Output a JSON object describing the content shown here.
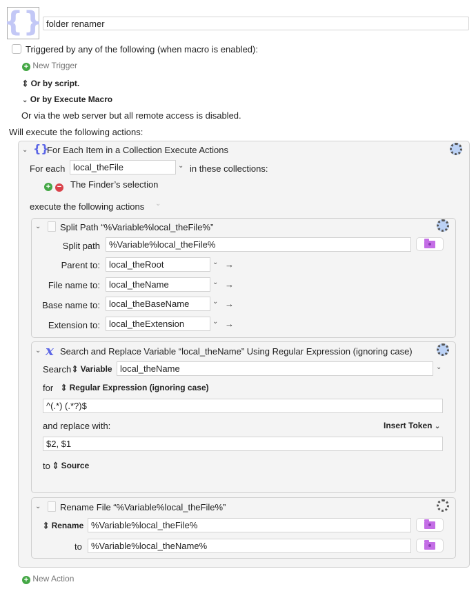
{
  "macro": {
    "name": "folder renamer",
    "icon": "curly-braces-icon"
  },
  "triggers": {
    "checkbox_label": "Triggered by any of the following (when macro is enabled):",
    "new_trigger": "New Trigger",
    "or_by_script": "Or by script.",
    "or_by_execute_macro": "Or by Execute Macro",
    "web_server_note": "Or via the web server but all remote access is disabled."
  },
  "will_execute_label": "Will execute the following actions:",
  "for_each": {
    "title": "For Each Item in a Collection Execute Actions",
    "for_each_label": "For each",
    "variable": "local_theFile",
    "in_collections_label": "in these collections:",
    "collection_item": "The Finder’s selection",
    "execute_label": "execute the following actions"
  },
  "split_path": {
    "title": "Split Path “%Variable%local_theFile%”",
    "split_path_label": "Split path",
    "split_path_value": "%Variable%local_theFile%",
    "rows": [
      {
        "label": "Parent to:",
        "value": "local_theRoot"
      },
      {
        "label": "File name to:",
        "value": "local_theName"
      },
      {
        "label": "Base name to:",
        "value": "local_theBaseName"
      },
      {
        "label": "Extension to:",
        "value": "local_theExtension"
      }
    ]
  },
  "search_replace": {
    "title": "Search and Replace Variable “local_theName” Using Regular Expression (ignoring case)",
    "search_label": "Search",
    "search_type": "Variable",
    "search_value": "local_theName",
    "for_label": "for",
    "for_type": "Regular Expression (ignoring case)",
    "pattern": "^(.*) (.*?)$",
    "replace_label": "and replace with:",
    "insert_token": "Insert Token",
    "replacement": "$2, $1",
    "to_label": "to",
    "to_value": "Source"
  },
  "rename_file": {
    "title": "Rename File “%Variable%local_theFile%”",
    "rename_label": "Rename",
    "rename_value": "%Variable%local_theFile%",
    "to_label": "to",
    "to_value": "%Variable%local_theName%"
  },
  "new_action": "New Action"
}
